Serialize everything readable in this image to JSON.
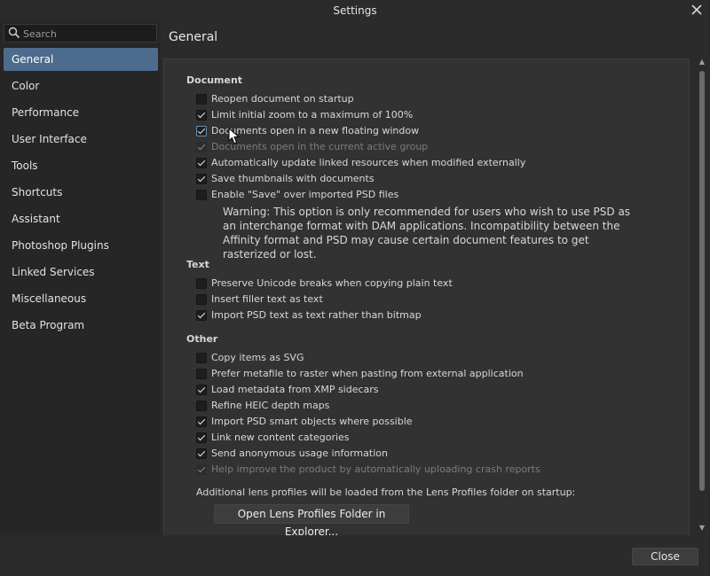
{
  "window": {
    "title": "Settings"
  },
  "search": {
    "placeholder": "Search"
  },
  "sidebar": {
    "items": [
      {
        "label": "General",
        "active": true
      },
      {
        "label": "Color"
      },
      {
        "label": "Performance"
      },
      {
        "label": "User Interface"
      },
      {
        "label": "Tools"
      },
      {
        "label": "Shortcuts"
      },
      {
        "label": "Assistant"
      },
      {
        "label": "Photoshop Plugins"
      },
      {
        "label": "Linked Services"
      },
      {
        "label": "Miscellaneous"
      },
      {
        "label": "Beta Program"
      }
    ]
  },
  "main": {
    "title": "General",
    "document": {
      "heading": "Document",
      "options": [
        {
          "label": "Reopen document on startup",
          "checked": false
        },
        {
          "label": "Limit initial zoom to a maximum of 100%",
          "checked": true
        },
        {
          "label": "Documents open in a new floating window",
          "checked": true
        },
        {
          "label": "Documents open in the current active group",
          "checked": true,
          "disabled": true
        },
        {
          "label": "Automatically update linked resources when modified externally",
          "checked": true
        },
        {
          "label": "Save thumbnails with documents",
          "checked": true
        },
        {
          "label": "Enable \"Save\" over imported PSD files",
          "checked": false
        }
      ],
      "warning": "Warning: This option is only recommended for users who wish to use PSD as an interchange format with DAM applications. Incompatibility between the Affinity format and PSD may cause certain document features to get rasterized or lost."
    },
    "text": {
      "heading": "Text",
      "options": [
        {
          "label": "Preserve Unicode breaks when copying plain text",
          "checked": false
        },
        {
          "label": "Insert filler text as text",
          "checked": false
        },
        {
          "label": "Import PSD text as text rather than bitmap",
          "checked": true
        }
      ]
    },
    "other": {
      "heading": "Other",
      "options": [
        {
          "label": "Copy items as SVG",
          "checked": false
        },
        {
          "label": "Prefer metafile to raster when pasting from external application",
          "checked": false
        },
        {
          "label": "Load metadata from XMP sidecars",
          "checked": true
        },
        {
          "label": "Refine HEIC depth maps",
          "checked": false
        },
        {
          "label": "Import PSD smart objects where possible",
          "checked": true
        },
        {
          "label": "Link new content categories",
          "checked": true
        },
        {
          "label": "Send anonymous usage information",
          "checked": true
        },
        {
          "label": "Help improve the product by automatically uploading crash reports",
          "checked": true,
          "disabled": true
        }
      ],
      "lens_note": "Additional lens profiles will be loaded from the Lens Profiles folder on startup:",
      "lens_button": "Open Lens Profiles Folder in Explorer..."
    }
  },
  "footer": {
    "close_label": "Close"
  }
}
